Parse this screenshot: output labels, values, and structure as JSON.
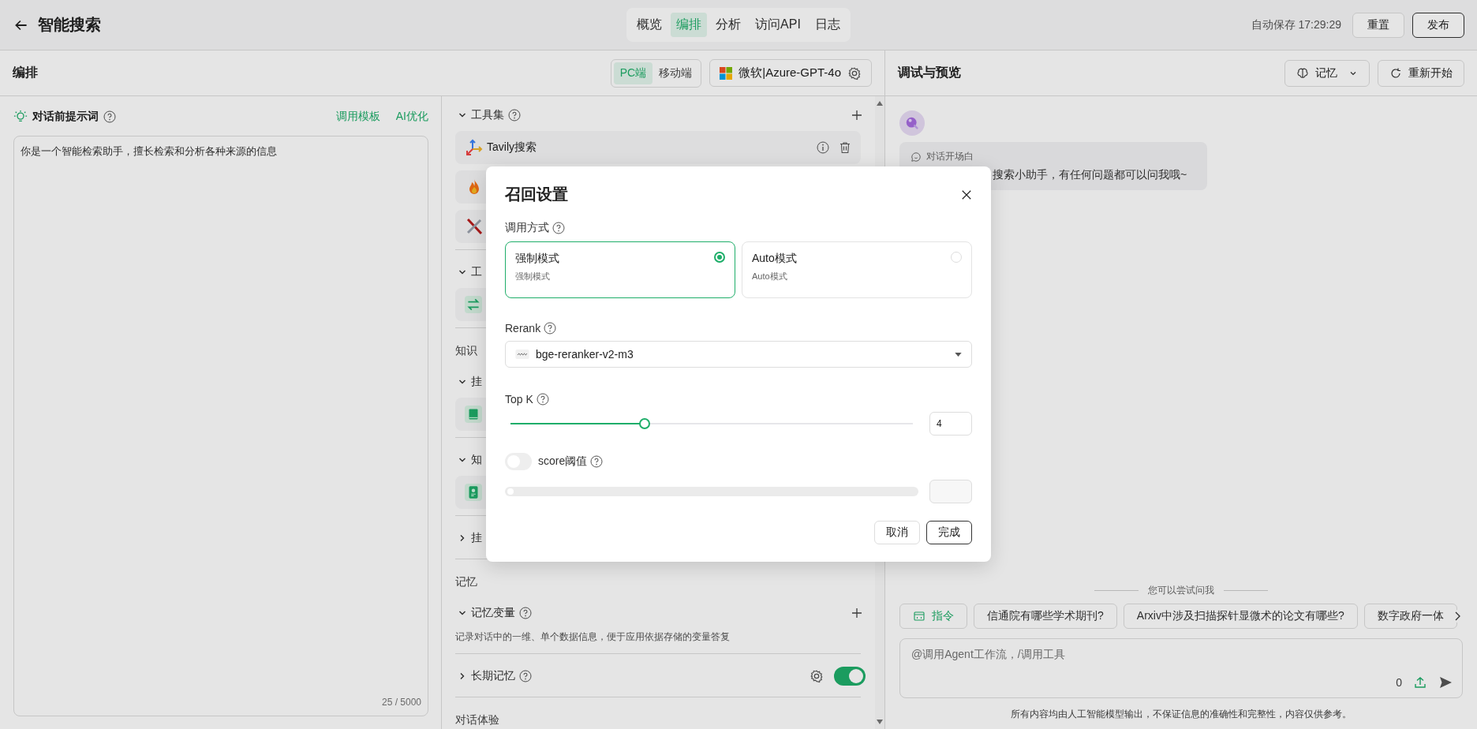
{
  "header": {
    "title": "智能搜索",
    "tabs": [
      {
        "label": "概览",
        "selected": false
      },
      {
        "label": "编排",
        "selected": true
      },
      {
        "label": "分析",
        "selected": false
      },
      {
        "label": "访问API",
        "selected": false
      },
      {
        "label": "日志",
        "selected": false
      }
    ],
    "autosave": "自动保存 17:29:29",
    "buttons": [
      {
        "label": "重置",
        "kind": "default"
      },
      {
        "label": "发布",
        "kind": "primary"
      }
    ]
  },
  "editor": {
    "title": "编排",
    "devices": [
      {
        "label": "PC端",
        "selected": true
      },
      {
        "label": "移动端",
        "selected": false
      }
    ],
    "model": "微软|Azure-GPT-4o"
  },
  "prompt": {
    "title": "对话前提示词",
    "links": [
      "调用模板",
      "AI优化"
    ],
    "value": "你是一个智能检索助手，擅长检索和分析各种来源的信息",
    "counter": "25 / 5000"
  },
  "config": [
    {
      "kind": "group",
      "title": "工具集",
      "expanded": true,
      "help": true,
      "add": true,
      "items": [
        {
          "kind": "tavily",
          "name": "Tavily搜索",
          "actions": true
        },
        {
          "kind": "flame"
        },
        {
          "kind": "cross"
        }
      ]
    },
    {
      "kind": "group",
      "title": "工",
      "expanded": true,
      "items": [
        {
          "kind": "swap"
        }
      ]
    },
    {
      "kind": "label",
      "title": "知识"
    },
    {
      "kind": "group",
      "title": "挂",
      "expanded": true,
      "items": [
        {
          "kind": "book"
        }
      ]
    },
    {
      "kind": "group",
      "title": "知",
      "expanded": true,
      "items": [
        {
          "kind": "doc"
        }
      ]
    },
    {
      "kind": "group",
      "title": "挂",
      "expanded": false
    },
    {
      "kind": "label",
      "title": "记忆"
    },
    {
      "kind": "group",
      "title": "记忆变量",
      "expanded": true,
      "help": true,
      "add": true,
      "description": "记录对话中的一维、单个数据信息，便于应用依据存储的变量答复"
    },
    {
      "kind": "group",
      "title": "长期记忆",
      "expanded": false,
      "help": true,
      "settings": true,
      "on": true
    },
    {
      "kind": "label",
      "title": "对话体验"
    }
  ],
  "preview": {
    "title": "调试与预览",
    "buttons": [
      {
        "label": "记忆",
        "kind": "memory"
      },
      {
        "label": "重新开始",
        "kind": "restart"
      }
    ],
    "greeting": {
      "label": "对话开场白",
      "text": "搜索小助手，有任何问题都可以问我哦~"
    },
    "suggest_title": "您可以尝试问我",
    "suggestions": [
      {
        "kind": "command",
        "label": "指令"
      },
      {
        "kind": "question",
        "label": "信通院有哪些学术期刊?"
      },
      {
        "kind": "question",
        "label": "Arxiv中涉及扫描探针显微术的论文有哪些?"
      },
      {
        "kind": "question",
        "label": "数字政府一体"
      }
    ],
    "input": {
      "placeholder": "@调用Agent工作流，/调用工具",
      "count": "0"
    },
    "disclaimer": "所有内容均由人工智能模型输出，不保证信息的准确性和完整性，内容仅供参考。"
  },
  "modal": {
    "title": "召回设置",
    "mode_label": "调用方式",
    "modes": [
      {
        "title": "强制模式",
        "desc": "强制模式",
        "selected": true
      },
      {
        "title": "Auto模式",
        "desc": "Auto模式",
        "selected": false
      }
    ],
    "rerank_label": "Rerank",
    "rerank": "bge-reranker-v2-m3",
    "topk": {
      "label": "Top K",
      "level": 0.333,
      "value": "4"
    },
    "score": {
      "label": "score阈值",
      "on": false,
      "level": 0
    },
    "buttons": [
      {
        "label": "取消",
        "kind": "default"
      },
      {
        "label": "完成",
        "kind": "primary"
      }
    ]
  }
}
